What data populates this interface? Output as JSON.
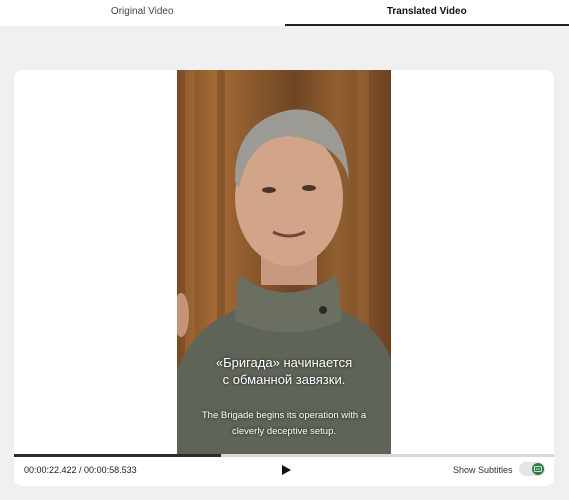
{
  "tabs": [
    {
      "label": "Original Video",
      "active": false
    },
    {
      "label": "Translated Video",
      "active": true
    }
  ],
  "video": {
    "subtitle_ru_line1": "«Бригада» начинается",
    "subtitle_ru_line2": "с обманной завязки.",
    "subtitle_en_line1": "The Brigade begins its operation with a",
    "subtitle_en_line2": "cleverly deceptive setup."
  },
  "player": {
    "time": "00:00:22.422 / 00:00:58.533",
    "progress": 0.383,
    "play_icon": "play-icon",
    "show_subtitles_label": "Show Subtitles",
    "show_subtitles_on": true
  },
  "colors": {
    "active_tab_underline": "#222222",
    "toggle_knob": "#2d7d46",
    "progress_fill": "#2b2b2b"
  }
}
